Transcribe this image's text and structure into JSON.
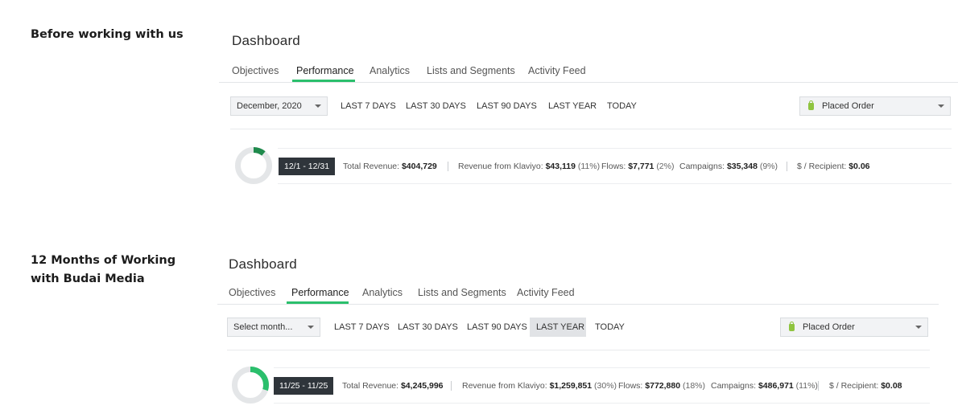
{
  "sections": [
    {
      "heading": "Before working with us",
      "dashboard": {
        "title": "Dashboard",
        "tabs": [
          "Objectives",
          "Performance",
          "Analytics",
          "Lists and Segments",
          "Activity Feed"
        ],
        "active_tab": "Performance",
        "month_select": "December, 2020",
        "ranges": [
          "LAST 7 DAYS",
          "LAST 30 DAYS",
          "LAST 90 DAYS",
          "LAST YEAR",
          "TODAY"
        ],
        "active_range": "",
        "metric_select": "Placed Order",
        "date_range": "12/1 - 12/31",
        "klaviyo_share": 0.11,
        "stats": {
          "total_revenue_label": "Total Revenue:",
          "total_revenue": "$404,729",
          "klaviyo_label": "Revenue from Klaviyo:",
          "klaviyo_value": "$43,119",
          "klaviyo_pct": "(11%)",
          "flows_label": "Flows:",
          "flows_value": "$7,771",
          "flows_pct": "(2%)",
          "campaigns_label": "Campaigns:",
          "campaigns_value": "$35,348",
          "campaigns_pct": "(9%)",
          "recipient_label": "$ / Recipient:",
          "recipient_value": "$0.06"
        }
      }
    },
    {
      "heading": "12 Months of Working with Budai Media",
      "dashboard": {
        "title": "Dashboard",
        "tabs": [
          "Objectives",
          "Performance",
          "Analytics",
          "Lists and Segments",
          "Activity Feed"
        ],
        "active_tab": "Performance",
        "month_select": "Select month...",
        "ranges": [
          "LAST 7 DAYS",
          "LAST 30 DAYS",
          "LAST 90 DAYS",
          "LAST YEAR",
          "TODAY"
        ],
        "active_range": "LAST YEAR",
        "metric_select": "Placed Order",
        "date_range": "11/25 - 11/25",
        "klaviyo_share": 0.3,
        "stats": {
          "total_revenue_label": "Total Revenue:",
          "total_revenue": "$4,245,996",
          "klaviyo_label": "Revenue from Klaviyo:",
          "klaviyo_value": "$1,259,851",
          "klaviyo_pct": "(30%)",
          "flows_label": "Flows:",
          "flows_value": "$772,880",
          "flows_pct": "(18%)",
          "campaigns_label": "Campaigns:",
          "campaigns_value": "$486,971",
          "campaigns_pct": "(11%)",
          "recipient_label": "$ / Recipient:",
          "recipient_value": "$0.08"
        }
      }
    }
  ],
  "colors": {
    "accent_green": "#2bbf6c",
    "donut_dark": "#1f8a4c",
    "donut_track": "#e4e6e8",
    "chip_bg": "#2f353b"
  },
  "icons": {
    "month_caret": "chevron-down-icon",
    "metric_caret": "chevron-down-icon",
    "metric_icon": "shopify-bag-icon"
  }
}
